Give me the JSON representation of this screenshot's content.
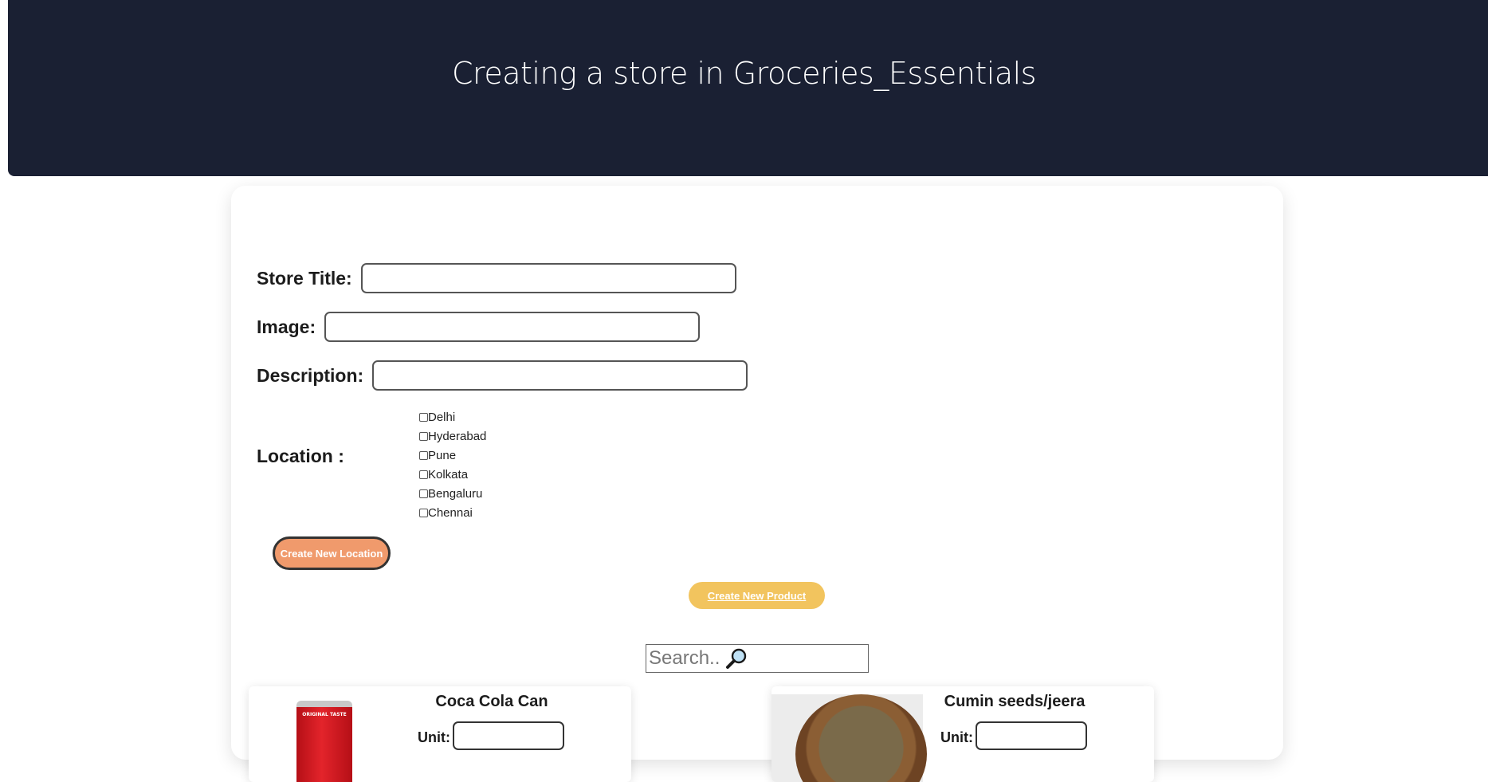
{
  "header": {
    "title": "Creating a store in Groceries_Essentials"
  },
  "form": {
    "store_title_label": "Store Title:",
    "store_title_value": "",
    "image_label": "Image:",
    "image_value": "",
    "description_label": "Description:",
    "description_value": "",
    "location_label": "Location :",
    "locations": [
      {
        "label": "Delhi",
        "checked": false
      },
      {
        "label": "Hyderabad",
        "checked": false
      },
      {
        "label": "Pune",
        "checked": false
      },
      {
        "label": "Kolkata",
        "checked": false
      },
      {
        "label": "Bengaluru",
        "checked": false
      },
      {
        "label": "Chennai",
        "checked": false
      }
    ]
  },
  "buttons": {
    "create_location": "Create New Location",
    "create_product": "Create New Product"
  },
  "search": {
    "placeholder": "Search..",
    "icon": "magnifier-icon"
  },
  "products": [
    {
      "name": "Coca Cola Can",
      "unit_label": "Unit:",
      "image_text": "ORIGINAL TASTE",
      "unit_value": ""
    },
    {
      "name": "Cumin seeds/jeera",
      "unit_label": "Unit:",
      "unit_value": ""
    }
  ],
  "colors": {
    "header_bg": "#1a2033",
    "create_location_bg": "#f09a6c",
    "create_product_bg": "#f2c45e"
  }
}
